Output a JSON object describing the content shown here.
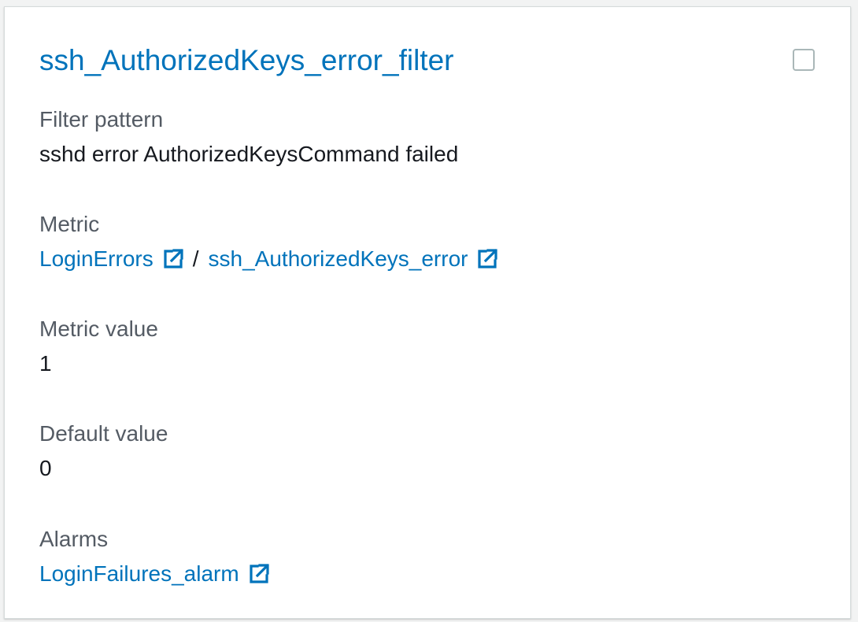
{
  "card": {
    "title": "ssh_AuthorizedKeys_error_filter",
    "checkbox_checked": false
  },
  "fields": {
    "filter_pattern": {
      "label": "Filter pattern",
      "value": "sshd error AuthorizedKeysCommand failed"
    },
    "metric": {
      "label": "Metric",
      "namespace_link": "LoginErrors",
      "separator": "/",
      "metric_link": "ssh_AuthorizedKeys_error"
    },
    "metric_value": {
      "label": "Metric value",
      "value": "1"
    },
    "default_value": {
      "label": "Default value",
      "value": "0"
    },
    "alarms": {
      "label": "Alarms",
      "alarm_link": "LoginFailures_alarm"
    }
  },
  "icons": {
    "external_link": "external-link-icon"
  },
  "colors": {
    "link": "#0073bb",
    "label": "#545b64",
    "value": "#16191f",
    "border": "#d5dbdb",
    "checkbox_border": "#aab7b8",
    "background": "#f2f3f3"
  }
}
